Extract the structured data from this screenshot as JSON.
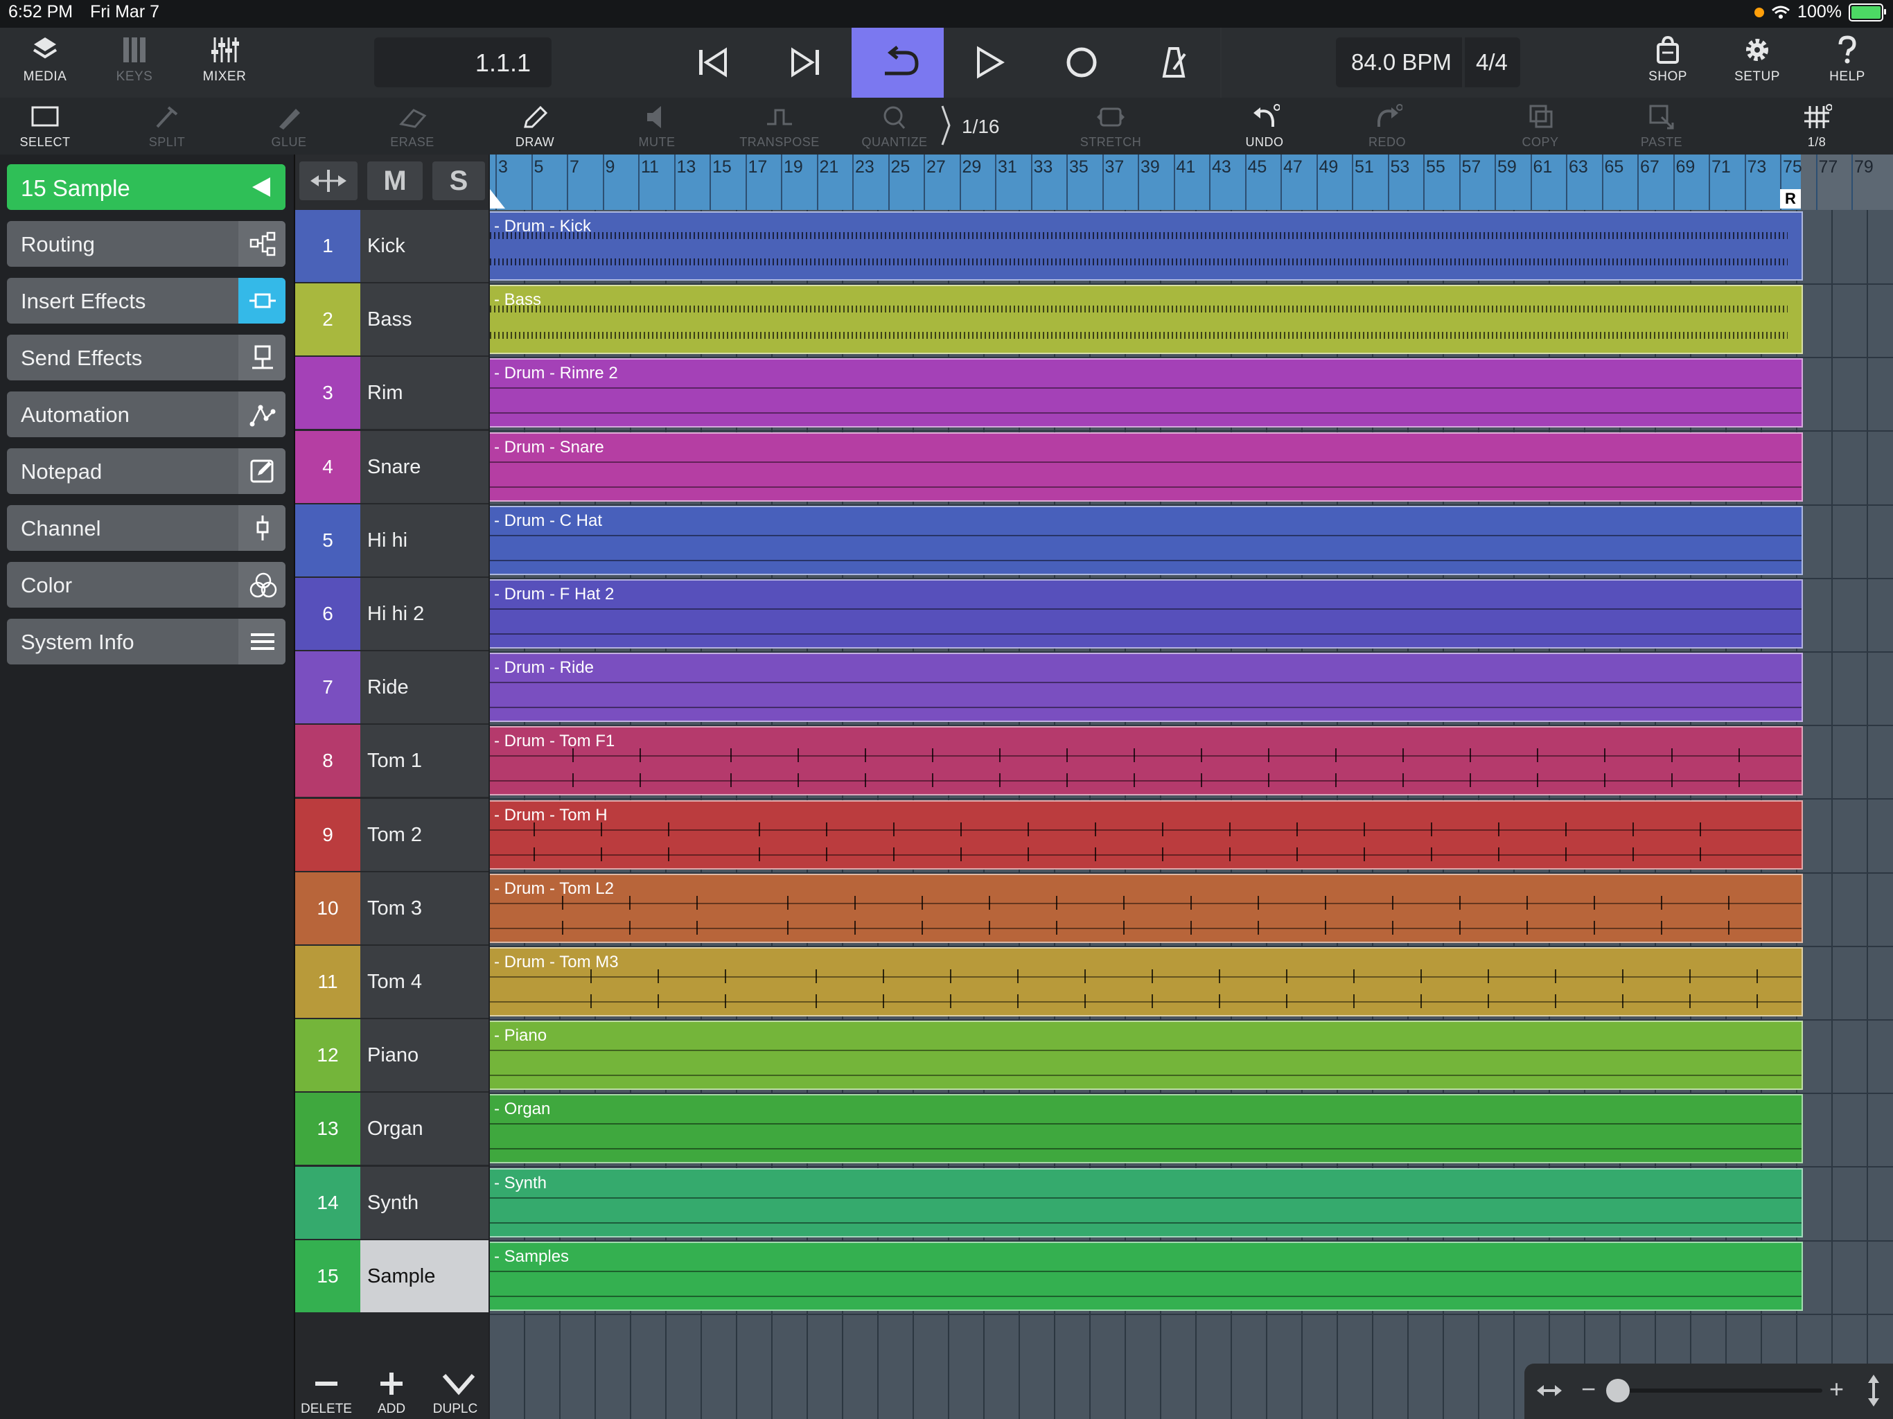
{
  "status": {
    "time": "6:52 PM",
    "date": "Fri Mar 7",
    "battery": "100%"
  },
  "toolbar": {
    "media": "MEDIA",
    "keys": "KEYS",
    "mixer": "MIXER",
    "position": "1.1.1",
    "bpm": "84.0 BPM",
    "signature": "4/4",
    "shop": "SHOP",
    "setup": "SETUP",
    "help": "HELP",
    "loop_active": true
  },
  "edit_tools": {
    "select": "SELECT",
    "split": "SPLIT",
    "glue": "GLUE",
    "erase": "ERASE",
    "draw": "DRAW",
    "mute": "MUTE",
    "transpose": "TRANSPOSE",
    "quantize": "QUANTIZE",
    "quantize_value": "1/16",
    "stretch": "STRETCH",
    "undo": "UNDO",
    "redo": "REDO",
    "copy": "COPY",
    "paste": "PASTE",
    "grid": "1/8"
  },
  "inspector": {
    "selected_label": "15  Sample",
    "items": [
      "Routing",
      "Insert Effects",
      "Send Effects",
      "Automation",
      "Notepad",
      "Channel",
      "Color",
      "System Info"
    ]
  },
  "track_header": {
    "mute": "M",
    "solo": "S"
  },
  "tracks": [
    {
      "num": "1",
      "name": "Kick",
      "color": "#4a62b8",
      "region": "- Drum - Kick",
      "style": "dense"
    },
    {
      "num": "2",
      "name": "Bass",
      "color": "#a8b83e",
      "region": "- Bass",
      "style": "dense"
    },
    {
      "num": "3",
      "name": "Rim",
      "color": "#a441b7",
      "region": "- Drum - Rimre 2",
      "style": "sparse"
    },
    {
      "num": "4",
      "name": "Snare",
      "color": "#b53ea3",
      "region": "- Drum - Snare",
      "style": "sparse"
    },
    {
      "num": "5",
      "name": "Hi hi",
      "color": "#4860bb",
      "region": "- Drum - C Hat",
      "style": "sparse"
    },
    {
      "num": "6",
      "name": "Hi hi 2",
      "color": "#5750bb",
      "region": "- Drum - F Hat 2",
      "style": "sparse"
    },
    {
      "num": "7",
      "name": "Ride",
      "color": "#7a4fc0",
      "region": "- Drum - Ride",
      "style": "sparse"
    },
    {
      "num": "8",
      "name": "Tom 1",
      "color": "#b53a6c",
      "region": "- Drum - Tom F1",
      "style": "hits"
    },
    {
      "num": "9",
      "name": "Tom 2",
      "color": "#bb3c3e",
      "region": "- Drum - Tom H",
      "style": "hits"
    },
    {
      "num": "10",
      "name": "Tom 3",
      "color": "#b8653a",
      "region": "- Drum - Tom L2",
      "style": "hits"
    },
    {
      "num": "11",
      "name": "Tom 4",
      "color": "#b89a3a",
      "region": "- Drum - Tom M3",
      "style": "hits"
    },
    {
      "num": "12",
      "name": "Piano",
      "color": "#74b53a",
      "region": "- Piano",
      "style": "sparse"
    },
    {
      "num": "13",
      "name": "Organ",
      "color": "#3fa83e",
      "region": "- Organ",
      "style": "sparse"
    },
    {
      "num": "14",
      "name": "Synth",
      "color": "#35aa6d",
      "region": "- Synth",
      "style": "sparse"
    },
    {
      "num": "15",
      "name": "Sample",
      "color": "#34b050",
      "region": "- Samples",
      "style": "sparse"
    }
  ],
  "ruler": {
    "labels": [
      "3",
      "5",
      "7",
      "9",
      "11",
      "13",
      "15",
      "17",
      "19",
      "21",
      "23",
      "25",
      "27",
      "29",
      "31",
      "33",
      "35",
      "37",
      "39",
      "41",
      "43",
      "45",
      "47",
      "49",
      "51",
      "53",
      "55",
      "57",
      "59",
      "61",
      "63",
      "65",
      "67",
      "69",
      "71",
      "73",
      "75",
      "77",
      "79"
    ],
    "end_marker": "R"
  },
  "footer": {
    "delete": "DELETE",
    "add": "ADD",
    "duplicate": "DUPLC"
  },
  "zoom": {
    "minus": "−",
    "plus": "+",
    "level": 0.08
  }
}
